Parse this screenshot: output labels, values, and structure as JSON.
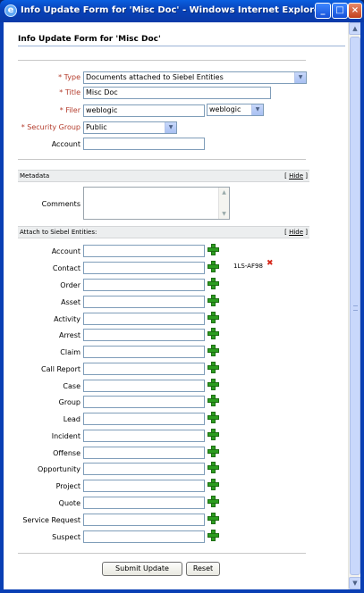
{
  "window": {
    "title": "Info Update Form for 'Misc Doc' - Windows Internet Explorer",
    "icon": "ie-icon"
  },
  "page": {
    "title": "Info Update Form for 'Misc Doc'"
  },
  "form": {
    "type": {
      "label": "Type",
      "value": "Documents attached to Siebel Entities"
    },
    "title": {
      "label": "Title",
      "value": "Misc Doc"
    },
    "filer": {
      "label": "Filer",
      "value": "weblogic",
      "select_value": "weblogic"
    },
    "security_group": {
      "label": "Security Group",
      "value": "Public"
    },
    "account": {
      "label": "Account",
      "value": ""
    }
  },
  "metadata": {
    "header": "Metadata",
    "hide_label": "Hide",
    "comments_label": "Comments",
    "comments_value": ""
  },
  "attach": {
    "header": "Attach to Siebel Entities:",
    "hide_label": "Hide",
    "entities": [
      "Account",
      "Contact",
      "Order",
      "Asset",
      "Activity",
      "Arrest",
      "Claim",
      "Call Report",
      "Case",
      "Group",
      "Lead",
      "Incident",
      "Offense",
      "Opportunity",
      "Project",
      "Quote",
      "Service Request",
      "Suspect"
    ],
    "contact_association": "1LS-AF98"
  },
  "buttons": {
    "submit": "Submit Update",
    "reset": "Reset"
  },
  "colors": {
    "required": "#b43c2c",
    "add_icon": "#2c9d1f",
    "remove_icon": "#d6271a",
    "titlebar": "#0842b8"
  }
}
